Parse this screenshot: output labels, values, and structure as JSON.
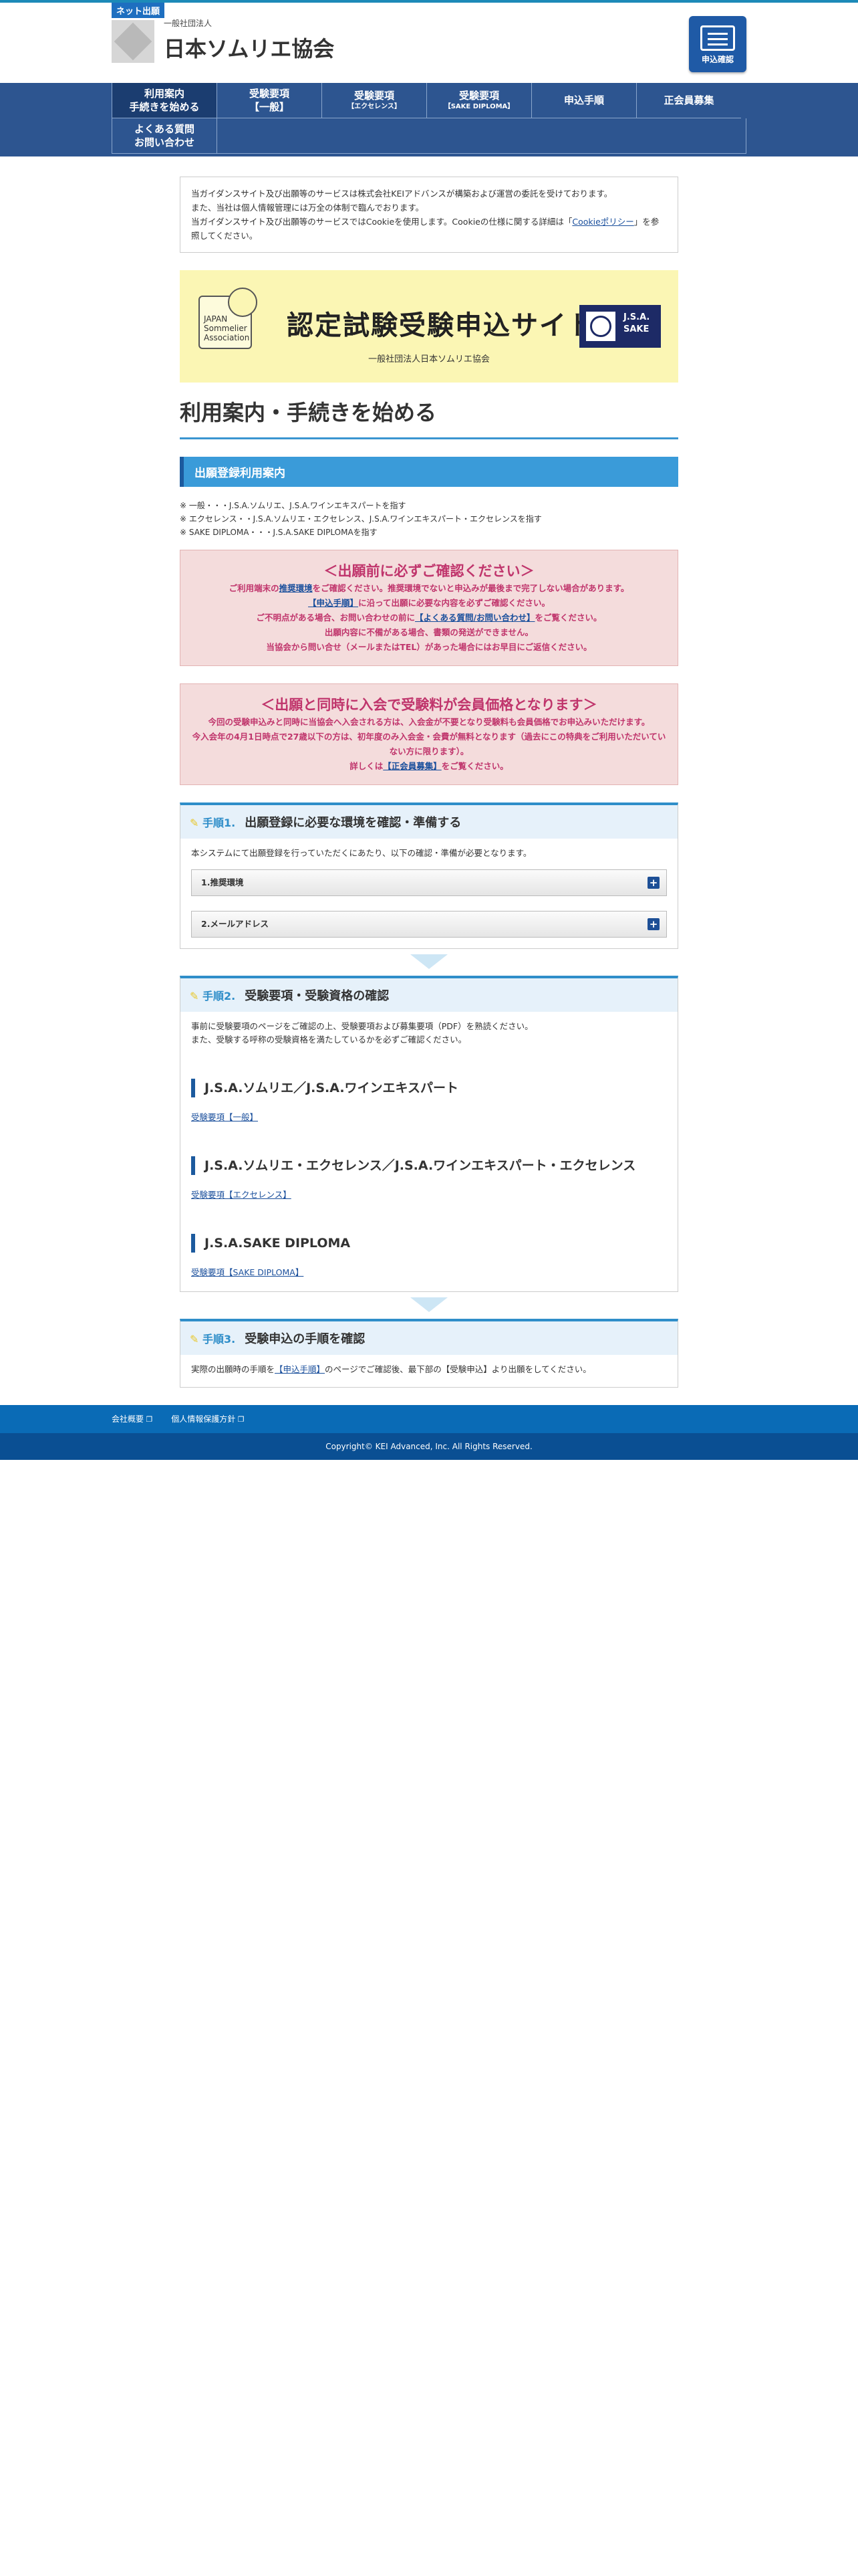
{
  "header": {
    "badge": "ネット出願",
    "org_small": "一般社団法人",
    "org_name": "日本ソムリエ協会",
    "apply_button": "申込確認"
  },
  "nav": {
    "items": [
      {
        "label": "利用案内",
        "label2": "手続きを始める",
        "active": true
      },
      {
        "label": "受験要項",
        "label2": "【一般】"
      },
      {
        "label": "受験要項",
        "label2": "【エクセレンス】"
      },
      {
        "label": "受験要項",
        "label2": "【SAKE DIPLOMA】"
      },
      {
        "label": "申込手順",
        "label2": ""
      },
      {
        "label": "正会員募集",
        "label2": ""
      },
      {
        "label": "よくある質問",
        "label2": "お問い合わせ"
      }
    ]
  },
  "notice": {
    "line1": "当ガイダンスサイト及び出願等のサービスは株式会社KEIアドバンスが構築および運営の委託を受けております。",
    "line2": "また、当社は個人情報管理には万全の体制で臨んでおります。",
    "line3a": "当ガイダンスサイト及び出願等のサービスではCookieを使用します。Cookieの仕様に関する詳細は「",
    "cookie_link": "Cookieポリシー",
    "line3b": "」を参照してください。"
  },
  "banner": {
    "jsa_logo": "JAPAN Sommelier Association",
    "title": "認定試験受験申込サイト",
    "subtitle": "一般社団法人日本ソムリエ協会",
    "sake_logo": "J.S.A. SAKE"
  },
  "page_title": "利用案内・手続きを始める",
  "section_title": "出願登録利用案内",
  "definitions": [
    "一般・・・J.S.A.ソムリエ、J.S.A.ワインエキスパートを指す",
    "エクセレンス・・J.S.A.ソムリエ・エクセレンス、J.S.A.ワインエキスパート・エクセレンスを指す",
    "SAKE DIPLOMA・・・J.S.A.SAKE DIPLOMAを指す"
  ],
  "alert1": {
    "title": "＜出願前に必ずご確認ください＞",
    "l1a": "ご利用端末の",
    "l1link": "推奨環境",
    "l1b": "をご確認ください。推奨環境でないと申込みが最後まで完了しない場合があります。",
    "l2link": "【申込手順】",
    "l2b": "に沿って出願に必要な内容を必ずご確認ください。",
    "l3a": "ご不明点がある場合、お問い合わせの前に",
    "l3link": "【よくある質問/お問い合わせ】",
    "l3b": "をご覧ください。",
    "l4": "出願内容に不備がある場合、書類の発送ができません。",
    "l5": "当協会から問い合せ（メールまたはTEL）があった場合にはお早目にご返信ください。"
  },
  "alert2": {
    "title": "＜出願と同時に入会で受験料が会員価格となります＞",
    "l1": "今回の受験申込みと同時に当協会へ入会される方は、入会金が不要となり受験料も会員価格でお申込みいただけます。",
    "l2": "今入会年の4月1日時点で27歳以下の方は、初年度のみ入会金・会費が無料となります（過去にこの特典をご利用いただいていない方に限ります）。",
    "l3a": "詳しくは",
    "l3link": "【正会員募集】",
    "l3b": "をご覧ください。"
  },
  "step1": {
    "num": "手順1.",
    "title": "出願登録に必要な環境を確認・準備する",
    "desc": "本システムにて出願登録を行っていただくにあたり、以下の確認・準備が必要となります。",
    "acc1": "1.推奨環境",
    "acc2": "2.メールアドレス",
    "plus": "+"
  },
  "step2": {
    "num": "手順2.",
    "title": "受験要項・受験資格の確認",
    "desc1": "事前に受験要項のページをご確認の上、受験要項および募集要項（PDF）を熟読ください。",
    "desc2": "また、受験する呼称の受験資格を満たしているかを必ずご確認ください。",
    "s1": "J.S.A.ソムリエ／J.S.A.ワインエキスパート",
    "s1link": "受験要項【一般】",
    "s2": "J.S.A.ソムリエ・エクセレンス／J.S.A.ワインエキスパート・エクセレンス",
    "s2link": "受験要項【エクセレンス】",
    "s3": "J.S.A.SAKE DIPLOMA",
    "s3link": "受験要項【SAKE DIPLOMA】"
  },
  "step3": {
    "num": "手順3.",
    "title": "受験申込の手順を確認",
    "desc_a": "実際の出願時の手順を",
    "desc_link": "【申込手順】",
    "desc_b": "のページでご確認後、最下部の【受験申込】より出願をしてください。"
  },
  "footer": {
    "link1": "会社概要",
    "link2": "個人情報保護方針",
    "copyright": "Copyright© KEI Advanced, Inc. All Rights Reserved."
  }
}
